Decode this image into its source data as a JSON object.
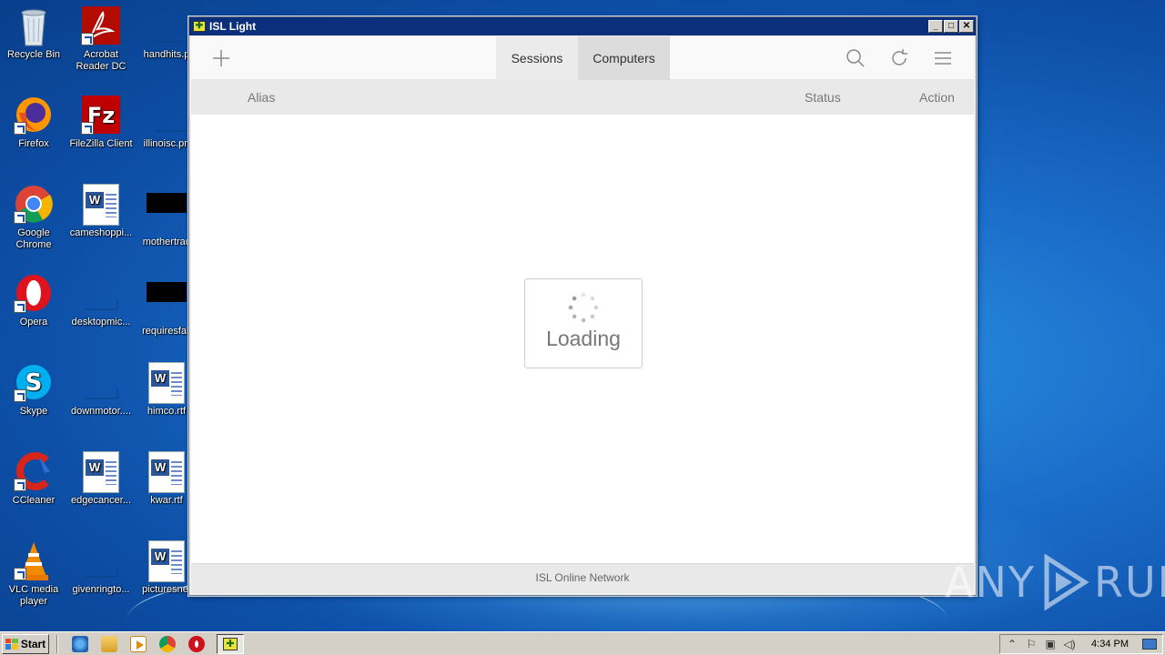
{
  "desktop": {
    "icons": [
      {
        "label": "Recycle Bin"
      },
      {
        "label": "Acrobat Reader DC"
      },
      {
        "label": "handhits.p"
      },
      {
        "label": "Firefox"
      },
      {
        "label": "FileZilla Client"
      },
      {
        "label": "illinoisc.pn"
      },
      {
        "label": "Google Chrome"
      },
      {
        "label": "cameshoppi..."
      },
      {
        "label": "mothertrac"
      },
      {
        "label": "Opera"
      },
      {
        "label": "desktopmic..."
      },
      {
        "label": "requiresfall"
      },
      {
        "label": "Skype"
      },
      {
        "label": "downmotor...."
      },
      {
        "label": "himco.rtf"
      },
      {
        "label": "CCleaner"
      },
      {
        "label": "edgecancer..."
      },
      {
        "label": "kwar.rtf"
      },
      {
        "label": "VLC media player"
      },
      {
        "label": "givenringto..."
      },
      {
        "label": "picturesnet"
      }
    ]
  },
  "window": {
    "title": "ISL Light",
    "toolbar": {
      "tabs": [
        {
          "label": "Sessions"
        },
        {
          "label": "Computers"
        }
      ]
    },
    "columns": {
      "alias": "Alias",
      "status": "Status",
      "action": "Action"
    },
    "loading_text": "Loading",
    "footer": "ISL Online Network"
  },
  "watermark": {
    "left": "ANY",
    "right": "RUN"
  },
  "taskbar": {
    "start_label": "Start",
    "clock": "4:34 PM"
  }
}
